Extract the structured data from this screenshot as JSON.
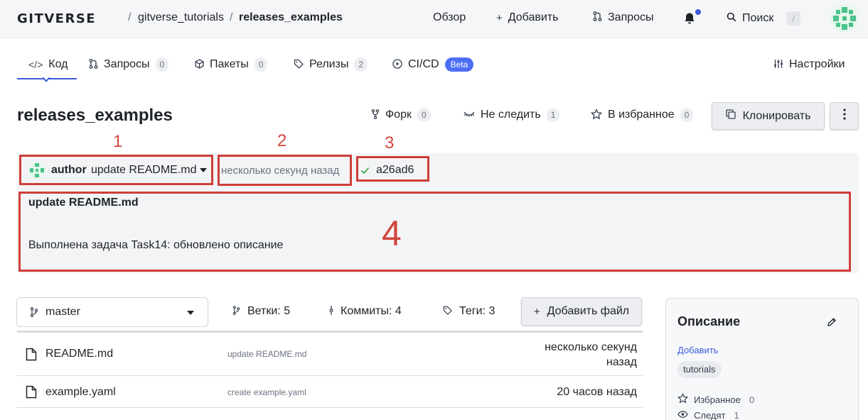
{
  "header": {
    "logo": "GITVERSE",
    "breadcrumb": [
      "gitverse_tutorials",
      "releases_examples"
    ],
    "separator": "/",
    "nav": {
      "overview": "Обзор",
      "add": "Добавить",
      "requests": "Запросы",
      "search": "Поиск",
      "search_shortcut": "/"
    }
  },
  "tabs": [
    {
      "label": "Код"
    },
    {
      "label": "Запросы",
      "count": "0"
    },
    {
      "label": "Пакеты",
      "count": "0"
    },
    {
      "label": "Релизы",
      "count": "2"
    },
    {
      "label": "CI/CD",
      "badge": "Beta"
    }
  ],
  "settings_label": "Настройки",
  "repo": {
    "name": "releases_examples",
    "fork_label": "Форк",
    "fork_count": "0",
    "watch_label": "Не следить",
    "watch_count": "1",
    "star_label": "В избранное",
    "star_count": "0",
    "clone_label": "Клонировать"
  },
  "commit": {
    "author": "author",
    "message": "update README.md",
    "time": "несколько секунд назад",
    "hash": "a26ad6",
    "title": "update README.md",
    "body": "Выполнена задача Task14: обновлено описание"
  },
  "annotations": [
    "1",
    "2",
    "3",
    "4"
  ],
  "branch_bar": {
    "branch": "master",
    "branches_label": "Ветки: 5",
    "commits_label": "Коммиты: 4",
    "tags_label": "Теги: 3",
    "add_file_label": "Добавить файл"
  },
  "files": [
    {
      "name": "README.md",
      "message": "update README.md",
      "date_line1": "несколько секунд",
      "date_line2": "назад"
    },
    {
      "name": "example.yaml",
      "message": "create example.yaml",
      "date_line1": "20 часов назад",
      "date_line2": ""
    }
  ],
  "sidebar": {
    "title": "Описание",
    "add_link": "Добавить",
    "tag": "tutorials",
    "stars_label": "Избранное",
    "stars_count": "0",
    "watchers_label": "Следят",
    "watchers_count": "1"
  },
  "colors": {
    "accent": "#3b5bdb",
    "annotation": "#cf3f39",
    "badge": "#4c6ef5"
  }
}
